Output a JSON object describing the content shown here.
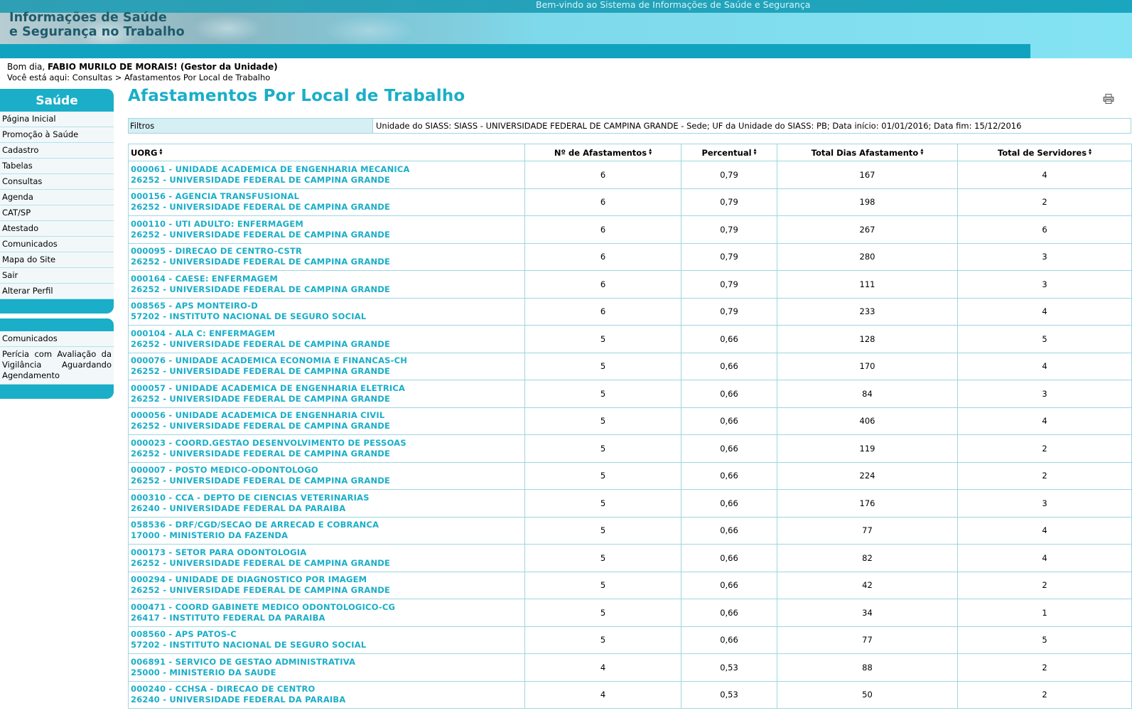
{
  "header": {
    "welcome": "Bem-vindo ao Sistema de Informações de Saúde e Segurança",
    "logo_line1": "Informações de Saúde",
    "logo_line2": "e Segurança no Trabalho"
  },
  "greeting": {
    "prefix": "Bom dia, ",
    "user": "FABIO MURILO DE MORAIS! (Gestor da Unidade)"
  },
  "breadcrumb": {
    "prefix": "Você está aqui: ",
    "items": [
      "Consultas",
      " > ",
      "Afastamentos Por Local de Trabalho"
    ]
  },
  "sidebar": {
    "title": "Saúde",
    "items": [
      {
        "label": "Página Inicial"
      },
      {
        "label": "Promoção à Saúde"
      },
      {
        "label": "Cadastro"
      },
      {
        "label": "Tabelas"
      },
      {
        "label": "Consultas"
      },
      {
        "label": "Agenda"
      },
      {
        "label": "CAT/SP"
      },
      {
        "label": "Atestado"
      },
      {
        "label": "Comunicados"
      },
      {
        "label": "Mapa do Site"
      },
      {
        "label": "Sair"
      },
      {
        "label": "Alterar Perfil"
      }
    ],
    "box2_items": [
      {
        "label": "Comunicados"
      },
      {
        "label": "Perícia com Avaliação da Vigilância Aguardando Agendamento"
      }
    ]
  },
  "main": {
    "title": "Afastamentos Por Local de Trabalho",
    "print_icon": "printer-icon",
    "filters_label": "Filtros",
    "filters_value": "Unidade do SIASS: SIASS - UNIVERSIDADE FEDERAL DE CAMPINA GRANDE - Sede; UF da Unidade do SIASS: PB; Data início: 01/01/2016; Data fim: 15/12/2016",
    "columns": [
      "UORG",
      "Nº de Afastamentos",
      "Percentual",
      "Total Dias Afastamento",
      "Total de Servidores"
    ],
    "sort_icon": "sort-arrows-icon",
    "rows": [
      {
        "uorg": "000061 - UNIDADE ACADEMICA DE ENGENHARIA MECANICA",
        "org": "26252 - UNIVERSIDADE FEDERAL DE CAMPINA GRANDE",
        "afast": "6",
        "perc": "0,79",
        "dias": "167",
        "serv": "4"
      },
      {
        "uorg": "000156 - AGENCIA TRANSFUSIONAL",
        "org": "26252 - UNIVERSIDADE FEDERAL DE CAMPINA GRANDE",
        "afast": "6",
        "perc": "0,79",
        "dias": "198",
        "serv": "2"
      },
      {
        "uorg": "000110 - UTI ADULTO: ENFERMAGEM",
        "org": "26252 - UNIVERSIDADE FEDERAL DE CAMPINA GRANDE",
        "afast": "6",
        "perc": "0,79",
        "dias": "267",
        "serv": "6"
      },
      {
        "uorg": "000095 - DIRECAO DE CENTRO-CSTR",
        "org": "26252 - UNIVERSIDADE FEDERAL DE CAMPINA GRANDE",
        "afast": "6",
        "perc": "0,79",
        "dias": "280",
        "serv": "3"
      },
      {
        "uorg": "000164 - CAESE: ENFERMAGEM",
        "org": "26252 - UNIVERSIDADE FEDERAL DE CAMPINA GRANDE",
        "afast": "6",
        "perc": "0,79",
        "dias": "111",
        "serv": "3"
      },
      {
        "uorg": "008565 - APS MONTEIRO-D",
        "org": "57202 - INSTITUTO NACIONAL DE SEGURO SOCIAL",
        "afast": "6",
        "perc": "0,79",
        "dias": "233",
        "serv": "4"
      },
      {
        "uorg": "000104 - ALA C: ENFERMAGEM",
        "org": "26252 - UNIVERSIDADE FEDERAL DE CAMPINA GRANDE",
        "afast": "5",
        "perc": "0,66",
        "dias": "128",
        "serv": "5"
      },
      {
        "uorg": "000076 - UNIDADE ACADEMICA ECONOMIA E FINANCAS-CH",
        "org": "26252 - UNIVERSIDADE FEDERAL DE CAMPINA GRANDE",
        "afast": "5",
        "perc": "0,66",
        "dias": "170",
        "serv": "4"
      },
      {
        "uorg": "000057 - UNIDADE ACADEMICA DE ENGENHARIA ELETRICA",
        "org": "26252 - UNIVERSIDADE FEDERAL DE CAMPINA GRANDE",
        "afast": "5",
        "perc": "0,66",
        "dias": "84",
        "serv": "3"
      },
      {
        "uorg": "000056 - UNIDADE ACADEMICA DE ENGENHARIA CIVIL",
        "org": "26252 - UNIVERSIDADE FEDERAL DE CAMPINA GRANDE",
        "afast": "5",
        "perc": "0,66",
        "dias": "406",
        "serv": "4"
      },
      {
        "uorg": "000023 - COORD.GESTAO DESENVOLVIMENTO DE PESSOAS",
        "org": "26252 - UNIVERSIDADE FEDERAL DE CAMPINA GRANDE",
        "afast": "5",
        "perc": "0,66",
        "dias": "119",
        "serv": "2"
      },
      {
        "uorg": "000007 - POSTO MEDICO-ODONTOLOGO",
        "org": "26252 - UNIVERSIDADE FEDERAL DE CAMPINA GRANDE",
        "afast": "5",
        "perc": "0,66",
        "dias": "224",
        "serv": "2"
      },
      {
        "uorg": "000310 - CCA - DEPTO DE CIENCIAS VETERINARIAS",
        "org": "26240 - UNIVERSIDADE FEDERAL DA PARAIBA",
        "afast": "5",
        "perc": "0,66",
        "dias": "176",
        "serv": "3"
      },
      {
        "uorg": "058536 - DRF/CGD/SECAO DE ARRECAD E COBRANCA",
        "org": "17000 - MINISTERIO DA FAZENDA",
        "afast": "5",
        "perc": "0,66",
        "dias": "77",
        "serv": "4"
      },
      {
        "uorg": "000173 - SETOR PARA ODONTOLOGIA",
        "org": "26252 - UNIVERSIDADE FEDERAL DE CAMPINA GRANDE",
        "afast": "5",
        "perc": "0,66",
        "dias": "82",
        "serv": "4"
      },
      {
        "uorg": "000294 - UNIDADE DE DIAGNOSTICO POR IMAGEM",
        "org": "26252 - UNIVERSIDADE FEDERAL DE CAMPINA GRANDE",
        "afast": "5",
        "perc": "0,66",
        "dias": "42",
        "serv": "2"
      },
      {
        "uorg": "000471 - COORD GABINETE MEDICO ODONTOLOGICO-CG",
        "org": "26417 - INSTITUTO FEDERAL DA PARAIBA",
        "afast": "5",
        "perc": "0,66",
        "dias": "34",
        "serv": "1"
      },
      {
        "uorg": "008560 - APS PATOS-C",
        "org": "57202 - INSTITUTO NACIONAL DE SEGURO SOCIAL",
        "afast": "5",
        "perc": "0,66",
        "dias": "77",
        "serv": "5"
      },
      {
        "uorg": "006891 - SERVICO DE GESTAO ADMINISTRATIVA",
        "org": "25000 - MINISTERIO DA SAUDE",
        "afast": "4",
        "perc": "0,53",
        "dias": "88",
        "serv": "2"
      },
      {
        "uorg": "000240 - CCHSA - DIRECAO DE CENTRO",
        "org": "26240 - UNIVERSIDADE FEDERAL DA PARAIBA",
        "afast": "4",
        "perc": "0,53",
        "dias": "50",
        "serv": "2"
      }
    ]
  },
  "colors": {
    "accent": "#1aaec8",
    "border": "#9fd6e1",
    "header_bar": "#10a3bf"
  }
}
